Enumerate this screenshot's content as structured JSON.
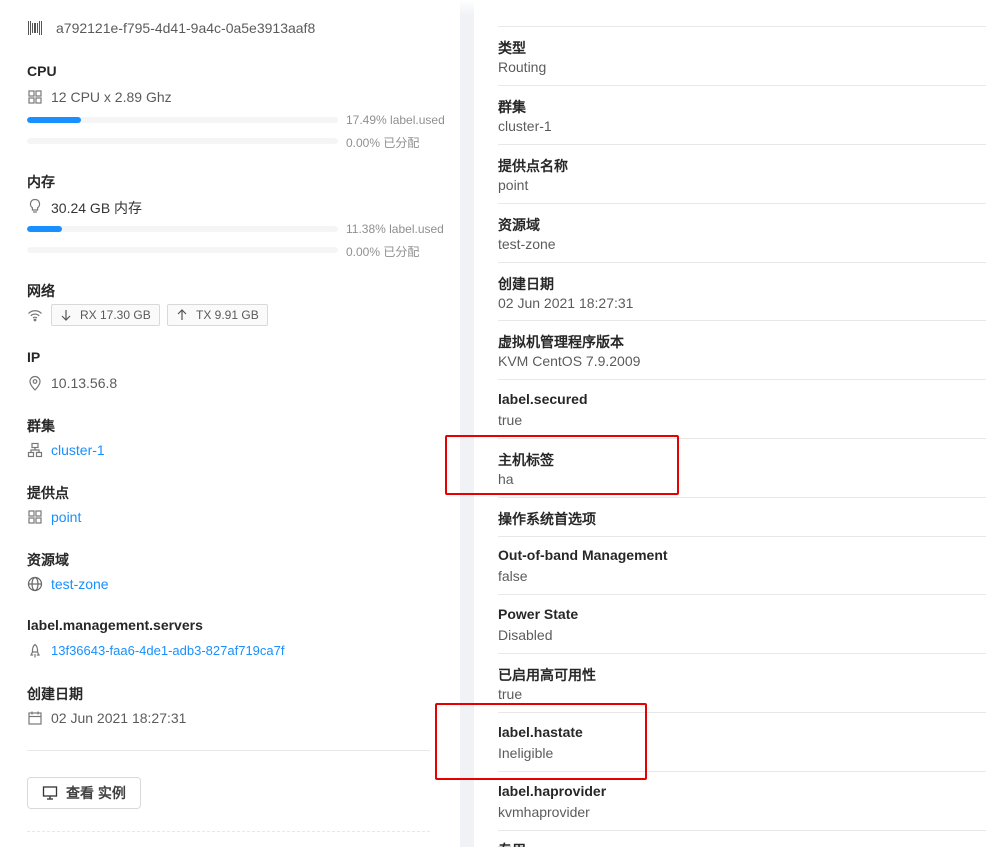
{
  "host": {
    "id": "a792121e-f795-4d41-9a4c-0a5e3913aaf8",
    "cpu": {
      "title": "CPU",
      "summary": "12 CPU x 2.89 Ghz",
      "used_pct": 0.1749,
      "used_label": "17.49% label.used",
      "alloc_pct": 0.0,
      "alloc_label": "0.00% 已分配"
    },
    "memory": {
      "title": "内存",
      "summary": "30.24 GB 内存",
      "used_pct": 0.1138,
      "used_label": "11.38% label.used",
      "alloc_pct": 0.0,
      "alloc_label": "0.00% 已分配"
    },
    "network": {
      "title": "网络",
      "rx": "RX 17.30 GB",
      "tx": "TX 9.91 GB"
    },
    "ip": {
      "title": "IP",
      "value": "10.13.56.8"
    },
    "cluster": {
      "title": "群集",
      "value": "cluster-1"
    },
    "pod": {
      "title": "提供点",
      "value": "point"
    },
    "zone": {
      "title": "资源域",
      "value": "test-zone"
    },
    "management": {
      "title": "label.management.servers",
      "value": "13f36643-faa6-4de1-adb3-827af719ca7f"
    },
    "created": {
      "title": "创建日期",
      "value": "02 Jun 2021 18:27:31"
    },
    "view_instances_label": "查看 实例"
  },
  "details": [
    {
      "label": "类型",
      "value": "Routing"
    },
    {
      "label": "群集",
      "value": "cluster-1"
    },
    {
      "label": "提供点名称",
      "value": "point"
    },
    {
      "label": "资源域",
      "value": "test-zone"
    },
    {
      "label": "创建日期",
      "value": "02 Jun 2021 18:27:31"
    },
    {
      "label": "虚拟机管理程序版本",
      "value": "KVM CentOS 7.9.2009"
    },
    {
      "label": "label.secured",
      "value": "true"
    },
    {
      "label": "主机标签",
      "value": "ha"
    },
    {
      "label": "操作系统首选项",
      "value": ""
    },
    {
      "label": "Out-of-band Management",
      "value": "false"
    },
    {
      "label": "Power State",
      "value": "Disabled"
    },
    {
      "label": "已启用高可用性",
      "value": "true"
    },
    {
      "label": "label.hastate",
      "value": "Ineligible"
    },
    {
      "label": "label.haprovider",
      "value": "kvmhaprovider"
    },
    {
      "label": "专用",
      "value": ""
    }
  ],
  "colors": {
    "accent": "#1890ff",
    "highlight": "#e60000"
  },
  "icons": [
    "barcode-icon",
    "cpu-icon",
    "bulb-icon",
    "wifi-icon",
    "arrow-down-icon",
    "arrow-up-icon",
    "location-icon",
    "cluster-icon",
    "pod-icon",
    "globe-icon",
    "rocket-icon",
    "calendar-icon",
    "desktop-icon"
  ]
}
